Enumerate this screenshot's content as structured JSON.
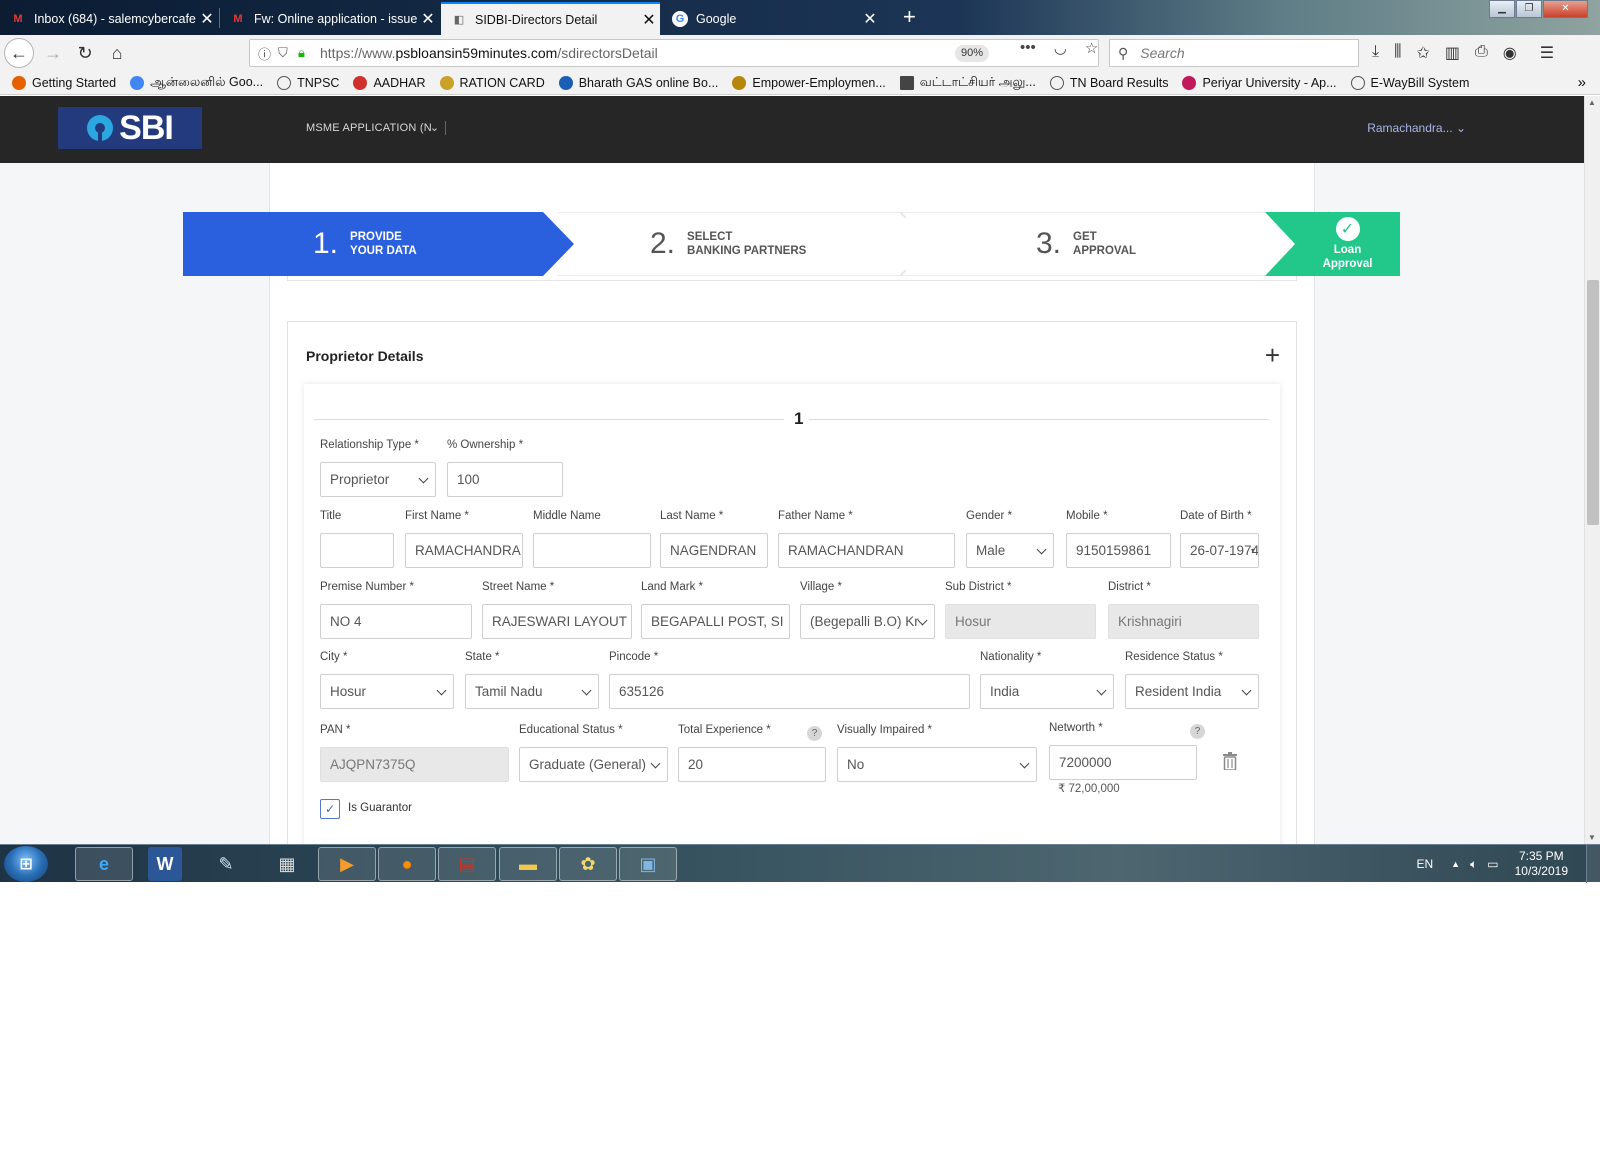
{
  "browser": {
    "tabs": [
      {
        "title": "Inbox (684) - salemcybercafe@",
        "icon": "gmail-icon",
        "active": false
      },
      {
        "title": "Fw: Online application - issue -",
        "icon": "gmail-icon",
        "active": false
      },
      {
        "title": "SIDBI-Directors Detail",
        "icon": "page-icon",
        "active": true
      },
      {
        "title": "Google",
        "icon": "google-icon",
        "active": false
      }
    ],
    "new_tab": "+",
    "url_prefix": "https://www.",
    "url_domain": "psbloansin59minutes.com",
    "url_path": "/sdirectorsDetail",
    "zoom": "90%",
    "search_placeholder": "Search",
    "bookmarks": [
      {
        "label": "Getting Started",
        "color": "#e66000"
      },
      {
        "label": "ஆன்லைனில் Goo...",
        "color": "#4285f4"
      },
      {
        "label": "TNPSC",
        "color": "#555555"
      },
      {
        "label": "AADHAR",
        "color": "#d0312d"
      },
      {
        "label": "RATION CARD",
        "color": "#c9a227"
      },
      {
        "label": "Bharath GAS online Bo...",
        "color": "#1a5fb4"
      },
      {
        "label": "Empower-Employmen...",
        "color": "#b8860b"
      },
      {
        "label": "வட்டாட்சியர் அலு...",
        "color": "#444444"
      },
      {
        "label": "TN Board Results",
        "color": "#555555"
      },
      {
        "label": "Periyar University - Ap...",
        "color": "#c2185b"
      },
      {
        "label": "E-WayBill System",
        "color": "#555555"
      }
    ]
  },
  "app": {
    "logo": "SBI",
    "menu": "MSME APPLICATION (N",
    "user": "Ramachandra..."
  },
  "stepper": {
    "steps": [
      {
        "num": "1.",
        "line1": "PROVIDE",
        "line2": "YOUR DATA"
      },
      {
        "num": "2.",
        "line1": "SELECT",
        "line2": "BANKING PARTNERS"
      },
      {
        "num": "3.",
        "line1": "GET",
        "line2": "APPROVAL"
      }
    ],
    "final_line1": "Loan",
    "final_line2": "Approval"
  },
  "section": {
    "title": "Proprietor Details",
    "add": "+",
    "index": "1"
  },
  "form": {
    "relationship_type": {
      "label": "Relationship Type *",
      "value": "Proprietor"
    },
    "ownership": {
      "label": "% Ownership *",
      "value": "100"
    },
    "title": {
      "label": "Title",
      "value": ""
    },
    "first_name": {
      "label": "First Name *",
      "value": "RAMACHANDRA"
    },
    "middle_name": {
      "label": "Middle Name",
      "value": ""
    },
    "last_name": {
      "label": "Last Name *",
      "value": "NAGENDRAN"
    },
    "father_name": {
      "label": "Father Name *",
      "value": "RAMACHANDRAN"
    },
    "gender": {
      "label": "Gender *",
      "value": "Male"
    },
    "mobile": {
      "label": "Mobile *",
      "value": "9150159861"
    },
    "dob": {
      "label": "Date of Birth *",
      "value": "26-07-1974"
    },
    "premise": {
      "label": "Premise Number *",
      "value": "NO 4"
    },
    "street": {
      "label": "Street Name *",
      "value": "RAJESWARI LAYOUT"
    },
    "landmark": {
      "label": "Land Mark *",
      "value": "BEGAPALLI POST, SI"
    },
    "village": {
      "label": "Village *",
      "value": "(Begepalli B.O) Kr"
    },
    "sub_district": {
      "label": "Sub District *",
      "value": "Hosur"
    },
    "district": {
      "label": "District *",
      "value": "Krishnagiri"
    },
    "city": {
      "label": "City *",
      "value": "Hosur"
    },
    "state": {
      "label": "State *",
      "value": "Tamil Nadu"
    },
    "pincode": {
      "label": "Pincode *",
      "value": "635126"
    },
    "nationality": {
      "label": "Nationality *",
      "value": "India"
    },
    "residence": {
      "label": "Residence Status *",
      "value": "Resident India"
    },
    "pan": {
      "label": "PAN *",
      "value": "AJQPN7375Q"
    },
    "education": {
      "label": "Educational Status *",
      "value": "Graduate (General)"
    },
    "experience": {
      "label": "Total Experience *",
      "value": "20"
    },
    "visually_impaired": {
      "label": "Visually Impaired *",
      "value": "No"
    },
    "networth": {
      "label": "Networth *",
      "value": "7200000",
      "formatted": "₹ 72,00,000"
    },
    "help_glyph": "?",
    "guarantor": {
      "label": "Is Guarantor",
      "checked": true,
      "mark": "✓"
    }
  },
  "taskbar": {
    "apps": [
      "internet-explorer",
      "word",
      "scanner",
      "calculator",
      "media-player",
      "firefox",
      "winrar",
      "file-explorer",
      "paint",
      "photo-viewer"
    ],
    "lang": "EN",
    "time": "7:35 PM",
    "date": "10/3/2019"
  }
}
